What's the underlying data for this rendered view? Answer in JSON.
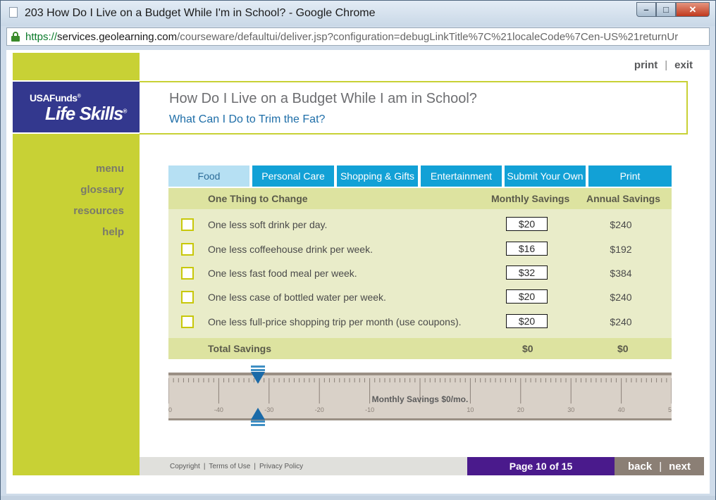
{
  "window": {
    "title": "203 How Do I Live on a Budget While I'm in School? - Google Chrome",
    "url_scheme": "https://",
    "url_host": "services.geolearning.com",
    "url_path": "/courseware/defaultui/deliver.jsp?configuration=debugLinkTitle%7C%21localeCode%7Cen-US%21returnUr"
  },
  "logo": {
    "line1": "USAFunds",
    "line1_mark": "®",
    "line2": "Life Skills",
    "line2_mark": "®"
  },
  "toplinks": {
    "print": "print",
    "sep": "|",
    "exit": "exit"
  },
  "header": {
    "title": "How Do I Live on a Budget While I am in School?",
    "subtitle": "What Can I Do to Trim the Fat?"
  },
  "nav": {
    "menu": "menu",
    "glossary": "glossary",
    "resources": "resources",
    "help": "help"
  },
  "tabs": [
    {
      "label": "Food",
      "active": true
    },
    {
      "label": "Personal Care",
      "active": false
    },
    {
      "label": "Shopping & Gifts",
      "active": false
    },
    {
      "label": "Entertainment",
      "active": false
    },
    {
      "label": "Submit Your Own",
      "active": false
    },
    {
      "label": "Print",
      "active": false
    }
  ],
  "table": {
    "headers": {
      "change": "One Thing to Change",
      "monthly": "Monthly Savings",
      "annual": "Annual Savings"
    },
    "rows": [
      {
        "label": "One less soft drink per day.",
        "monthly": "$20",
        "annual": "$240",
        "checked": false
      },
      {
        "label": "One less coffeehouse drink per week.",
        "monthly": "$16",
        "annual": "$192",
        "checked": false
      },
      {
        "label": "One less fast food meal per week.",
        "monthly": "$32",
        "annual": "$384",
        "checked": false
      },
      {
        "label": "One less case of bottled water per week.",
        "monthly": "$20",
        "annual": "$240",
        "checked": false
      },
      {
        "label": "One less full-price shopping trip per month (use coupons).",
        "monthly": "$20",
        "annual": "$240",
        "checked": false
      }
    ],
    "total": {
      "label": "Total Savings",
      "monthly": "$0",
      "annual": "$0"
    }
  },
  "slider": {
    "label": "Monthly Savings $0/mo.",
    "value": 0,
    "min": -50,
    "max": 50,
    "tick_labels": [
      "0",
      "-40",
      "-30",
      "-20",
      "-10",
      "",
      "10",
      "20",
      "30",
      "40",
      "5"
    ]
  },
  "footer": {
    "copyright": "Copyright",
    "terms": "Terms of Use",
    "privacy": "Privacy Policy",
    "sep": "|",
    "page": "Page 10 of 15",
    "back": "back",
    "next": "next"
  },
  "colors": {
    "sidebar": "#c8d135",
    "logo_bg": "#33388e",
    "tab": "#12a1d6",
    "tab_active": "#b6e0f3",
    "page_bar": "#4a1a8c",
    "nav_btns": "#8b7f75"
  }
}
